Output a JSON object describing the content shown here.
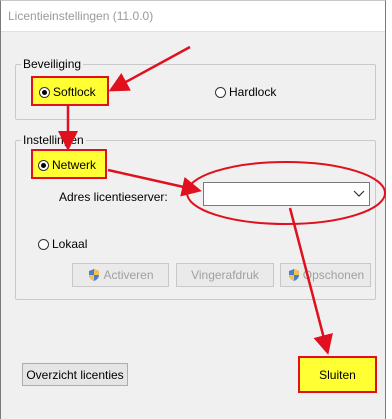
{
  "window": {
    "title": "Licentieinstellingen (11.0.0)"
  },
  "beveiliging": {
    "label": "Beveiliging",
    "softlock": {
      "label": "Softlock",
      "checked": true
    },
    "hardlock": {
      "label": "Hardlock",
      "checked": false
    }
  },
  "instellingen": {
    "label": "Instellingen",
    "netwerk": {
      "label": "Netwerk",
      "checked": true
    },
    "server_label": "Adres licentieserver:",
    "server_value": "",
    "lokaal": {
      "label": "Lokaal",
      "checked": false
    },
    "buttons": {
      "activeren": "Activeren",
      "vingerafdruk": "Vingerafdruk",
      "opschonen": "Opschonen"
    }
  },
  "footer": {
    "overview_label": "Overzicht licenties",
    "close_label": "Sluiten"
  },
  "colors": {
    "annotation_red": "#e0101e",
    "highlight_yellow": "#ffff33",
    "window_bg": "#f0f0f0",
    "title_text": "#9a9a9a"
  },
  "icons": [
    "shield-icon",
    "chevron-down-icon",
    "radio-icon"
  ]
}
